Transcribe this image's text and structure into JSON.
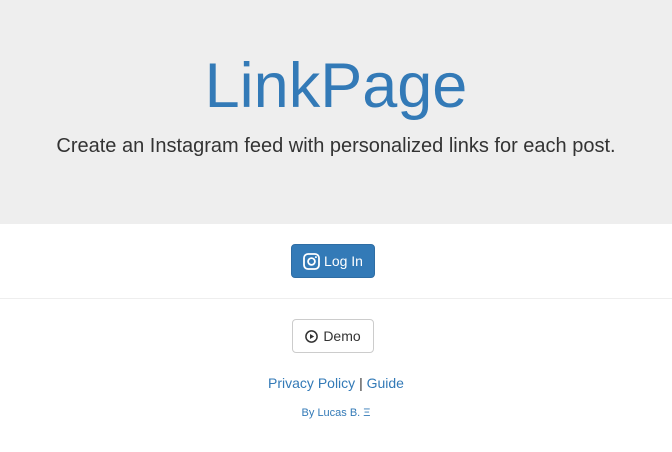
{
  "hero": {
    "title": "LinkPage",
    "subtitle": "Create an Instagram feed with personalized links for each post."
  },
  "login": {
    "label": "Log In",
    "icon": "instagram-icon"
  },
  "demo": {
    "label": "Demo",
    "icon": "play-circle-icon"
  },
  "footer": {
    "privacy_label": "Privacy Policy",
    "separator": "|",
    "guide_label": "Guide",
    "author_label": "By Lucas B. Ξ"
  },
  "colors": {
    "hero_bg": "#eeeeee",
    "brand_blue": "#337ab7",
    "text": "#333333"
  }
}
